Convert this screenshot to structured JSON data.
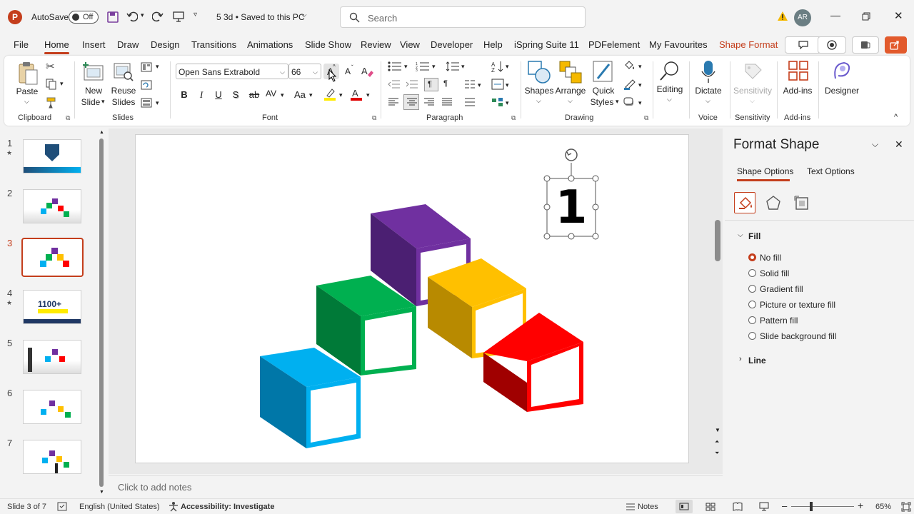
{
  "titlebar": {
    "autosave_label": "AutoSave",
    "autosave_state": "Off",
    "doc_title": "5 3d  •  Saved to this PC",
    "search_placeholder": "Search",
    "avatar_initials": "AR"
  },
  "menu": {
    "items": [
      "File",
      "Home",
      "Insert",
      "Draw",
      "Design",
      "Transitions",
      "Animations",
      "Slide Show",
      "Review",
      "View",
      "Developer",
      "Help",
      "iSpring Suite 11",
      "PDFelement",
      "My Favourites",
      "Shape Format"
    ],
    "active": "Home"
  },
  "ribbon": {
    "clipboard": {
      "paste": "Paste",
      "group": "Clipboard"
    },
    "slides": {
      "new_slide": "New",
      "new_slide2": "Slide",
      "reuse": "Reuse",
      "reuse2": "Slides",
      "group": "Slides"
    },
    "font": {
      "family": "Open Sans Extrabold",
      "size": "66",
      "bold": "B",
      "italic": "I",
      "underline": "U",
      "shadow": "S",
      "strike": "ab",
      "spacing": "AV",
      "case": "Aa",
      "grow": "A",
      "shrink": "A",
      "group": "Font"
    },
    "paragraph": {
      "group": "Paragraph"
    },
    "drawing": {
      "shapes": "Shapes",
      "arrange": "Arrange",
      "quick": "Quick",
      "quick2": "Styles",
      "group": "Drawing"
    },
    "editing": {
      "label": "Editing"
    },
    "voice": {
      "dictate": "Dictate",
      "group": "Voice"
    },
    "sensitivity": {
      "label": "Sensitivity",
      "group": "Sensitivity"
    },
    "addins": {
      "label": "Add-ins",
      "group": "Add-ins"
    },
    "designer": {
      "label": "Designer"
    }
  },
  "slides": [
    {
      "num": "1",
      "star": "★"
    },
    {
      "num": "2",
      "star": ""
    },
    {
      "num": "3",
      "star": ""
    },
    {
      "num": "4",
      "star": "★"
    },
    {
      "num": "5",
      "star": ""
    },
    {
      "num": "6",
      "star": ""
    },
    {
      "num": "7",
      "star": ""
    }
  ],
  "thumb4_text": "1100+",
  "slide_canvas": {
    "selected_text": "1"
  },
  "notes_placeholder": "Click to add notes",
  "format_pane": {
    "title": "Format Shape",
    "tabs": [
      "Shape Options",
      "Text Options"
    ],
    "fill_section": "Fill",
    "fill_options": [
      "No fill",
      "Solid fill",
      "Gradient fill",
      "Picture or texture fill",
      "Pattern fill",
      "Slide background fill"
    ],
    "selected_fill": "No fill",
    "line_section": "Line"
  },
  "statusbar": {
    "slide_info": "Slide 3 of 7",
    "language": "English (United States)",
    "accessibility": "Accessibility: Investigate",
    "notes": "Notes",
    "zoom": "65%"
  },
  "colors": {
    "accent": "#c43e1c",
    "blue": "#00b0f0",
    "green": "#00b050",
    "purple": "#7030a0",
    "yellow": "#ffc000",
    "red": "#ff0000"
  }
}
